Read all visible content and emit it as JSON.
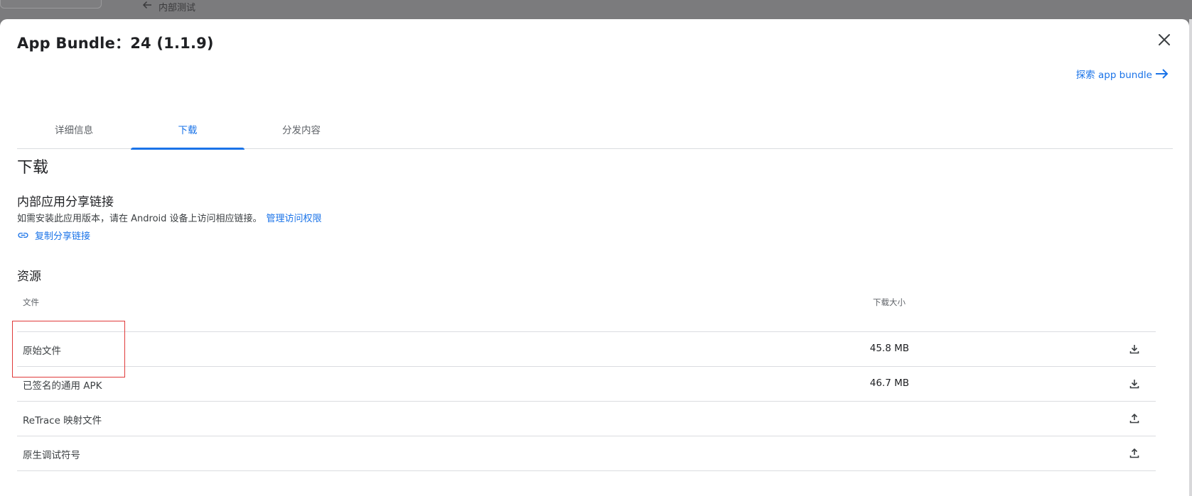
{
  "background": {
    "breadcrumb_label": "内部测试"
  },
  "dialog": {
    "title": "App Bundle：24 (1.1.9)",
    "explore_link": "探索 app bundle",
    "tabs": [
      {
        "label": "详细信息",
        "active": false
      },
      {
        "label": "下载",
        "active": true
      },
      {
        "label": "分发内容",
        "active": false
      }
    ],
    "download_heading": "下载",
    "share": {
      "heading": "内部应用分享链接",
      "description": "如需安装此应用版本，请在 Android 设备上访问相应链接。",
      "manage_link": "管理访问权限",
      "copy_link": "复制分享链接"
    },
    "resources": {
      "heading": "资源",
      "columns": {
        "file": "文件",
        "size": "下载大小"
      },
      "rows": [
        {
          "name": "原始文件",
          "size": "45.8 MB",
          "action": "download-icon"
        },
        {
          "name": "已签名的通用 APK",
          "size": "46.7 MB",
          "action": "download-icon"
        },
        {
          "name": "ReTrace 映射文件",
          "size": "",
          "action": "upload-icon"
        },
        {
          "name": "原生调试符号",
          "size": "",
          "action": "upload-icon"
        }
      ]
    }
  },
  "colors": {
    "accent": "#1a73e8",
    "highlight": "#e03a3a",
    "backdrop": "#7b7b7d"
  }
}
